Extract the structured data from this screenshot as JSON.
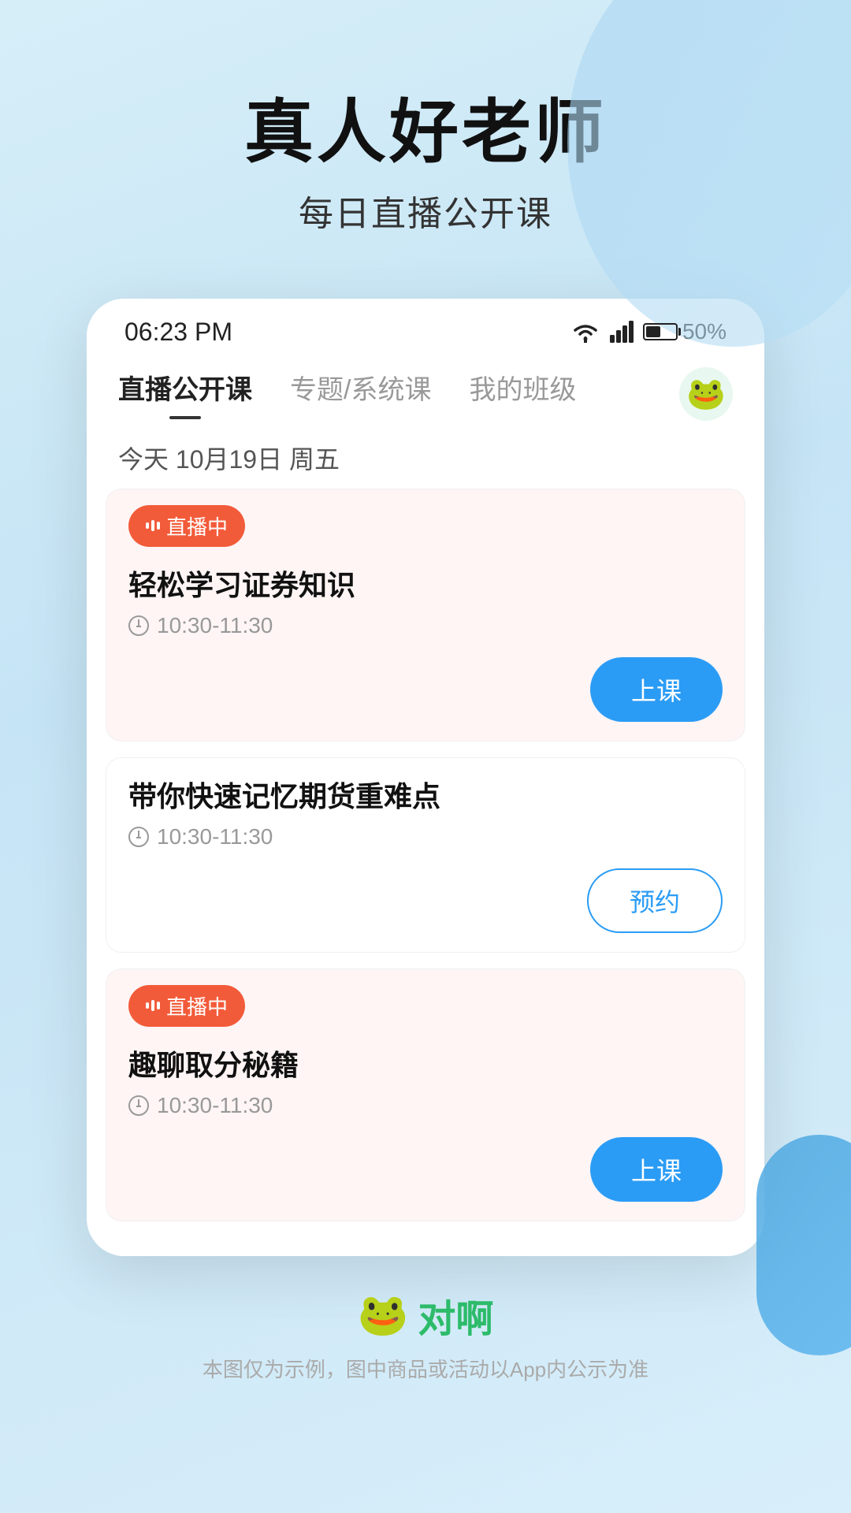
{
  "background": {
    "gradient_start": "#d6eef8",
    "gradient_end": "#c5e4f5"
  },
  "hero": {
    "title": "真人好老师",
    "subtitle": "每日直播公开课"
  },
  "status_bar": {
    "time": "06:23 PM",
    "battery_percent": "50%"
  },
  "nav": {
    "tabs": [
      {
        "label": "直播公开课",
        "active": true
      },
      {
        "label": "专题/系统课",
        "active": false
      },
      {
        "label": "我的班级",
        "active": false
      }
    ],
    "avatar_label": "🐸"
  },
  "date_header": {
    "text": "今天 10月19日 周五"
  },
  "courses": [
    {
      "id": "course-1",
      "is_live": true,
      "live_label": "直播中",
      "title": "轻松学习证券知识",
      "time": "10:30-11:30",
      "action": "join",
      "action_label": "上课"
    },
    {
      "id": "course-2",
      "is_live": false,
      "title": "带你快速记忆期货重难点",
      "time": "10:30-11:30",
      "action": "reserve",
      "action_label": "预约"
    },
    {
      "id": "course-3",
      "is_live": true,
      "live_label": "直播中",
      "title": "趣聊取分秘籍",
      "time": "10:30-11:30",
      "action": "join",
      "action_label": "上课"
    }
  ],
  "footer": {
    "logo_icon": "🐸",
    "logo_text": "对啊",
    "disclaimer": "本图仅为示例，图中商品或活动以App内公示为准"
  }
}
